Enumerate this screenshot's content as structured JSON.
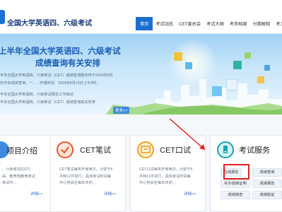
{
  "header": {
    "site_title": "全国大学英语四、六级考试",
    "nav": [
      "首页",
      "考试动态",
      "CET委员会",
      "考试大纲",
      "考务档案",
      "分数解释",
      "考三问题"
    ]
  },
  "banner": {
    "title_line1": "上半年全国大学英语四、六级考试",
    "title_line2": "成绩查询有关安排",
    "lines": [
      "半年全国大学英语四、六级考试（CET）成绩查询服务将于2024年8月",
      "并开启成绩查询，一、...开通时间　2024年8月23日上午9时...",
      "半年全国大学英语四、六级考试报名工作启动",
      "半年全国大学英语四、六级考试（CET）成绩查询有关安排"
    ],
    "more": "更多>>"
  },
  "cards": {
    "intro": {
      "title": "项目介绍",
      "lines": [
        "、六级考试(CET)",
        "由、教育部教育考试",
        "考试中..."
      ],
      "link": "详细>>"
    },
    "written": {
      "title": "CET笔试",
      "lines": [
        "CET笔试每年开考两次，分别于6",
        "月和12月举行，具体考试时间每",
        "中心将会在每年年初..."
      ],
      "link": "详细>>"
    },
    "oral": {
      "title": "CET口试",
      "lines": [
        "CET口试每年开考两次，分别于5",
        "月和11月举行，具体考试时间每",
        "中心将会在每年年初..."
      ],
      "link": "详细>>"
    },
    "service": {
      "title": "考试服务",
      "buttons": [
        "在线报名",
        "成绩查询",
        "补办成绩证明",
        "成绩报告",
        "成绩核查",
        "成绩验证"
      ]
    }
  },
  "colors": {
    "primary": "#1c6fd1",
    "title": "#1a5fb4",
    "alert": "#e02020",
    "written_icon": "#e7582c",
    "oral_icon": "#f0a020",
    "service_icon": "#18a2b8"
  },
  "icons": [
    "book-icon",
    "checkmark-icon",
    "certificate-icon",
    "phone-icon"
  ]
}
